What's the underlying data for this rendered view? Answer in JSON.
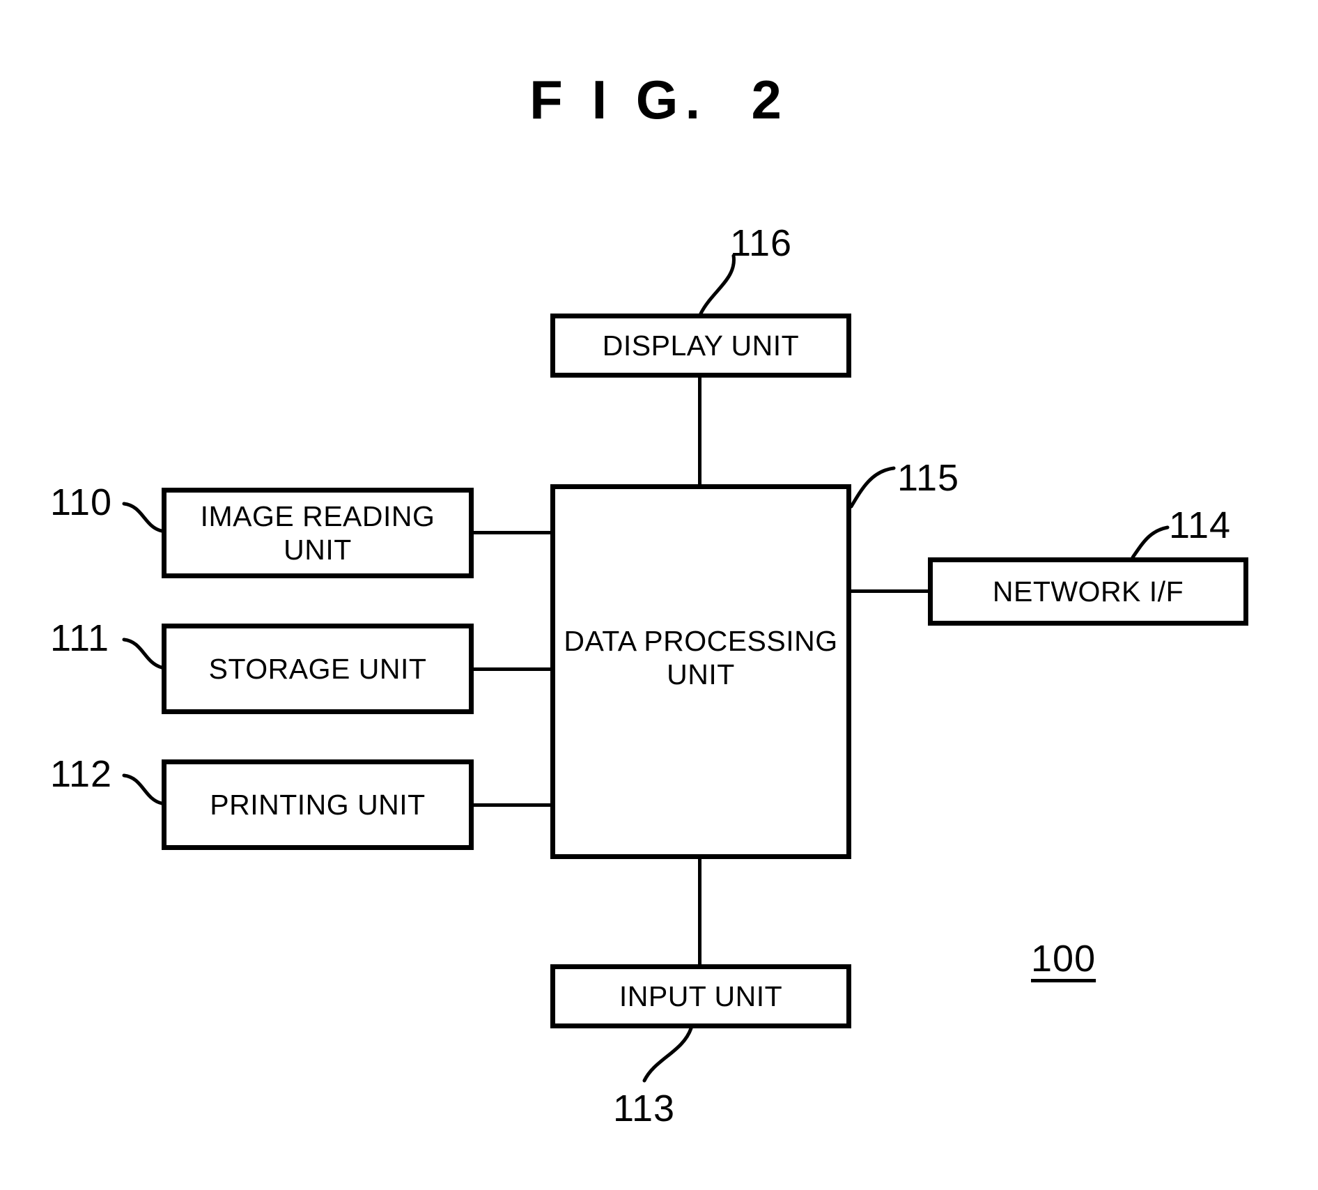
{
  "figure": {
    "title": "F I G.  2",
    "system_numeral": "100"
  },
  "blocks": [
    {
      "id": "display",
      "label": "DISPLAY UNIT",
      "numeral": "116"
    },
    {
      "id": "image-read",
      "label": "IMAGE READING\nUNIT",
      "numeral": "110"
    },
    {
      "id": "storage",
      "label": "STORAGE UNIT",
      "numeral": "111"
    },
    {
      "id": "printing",
      "label": "PRINTING UNIT",
      "numeral": "112"
    },
    {
      "id": "data-proc",
      "label": "DATA PROCESSING\nUNIT",
      "numeral": "115"
    },
    {
      "id": "network",
      "label": "NETWORK I/F",
      "numeral": "114"
    },
    {
      "id": "input",
      "label": "INPUT UNIT",
      "numeral": "113"
    }
  ],
  "labels": {
    "display": "DISPLAY UNIT",
    "image_read": "IMAGE READING\nUNIT",
    "storage": "STORAGE UNIT",
    "printing": "PRINTING UNIT",
    "data_proc": "DATA PROCESSING\nUNIT",
    "network": "NETWORK I/F",
    "input": "INPUT UNIT"
  },
  "numerals": {
    "n110": "110",
    "n111": "111",
    "n112": "112",
    "n113": "113",
    "n114": "114",
    "n115": "115",
    "n116": "116",
    "n100": "100"
  },
  "colors": {
    "ink": "#000000",
    "paper": "#ffffff"
  }
}
